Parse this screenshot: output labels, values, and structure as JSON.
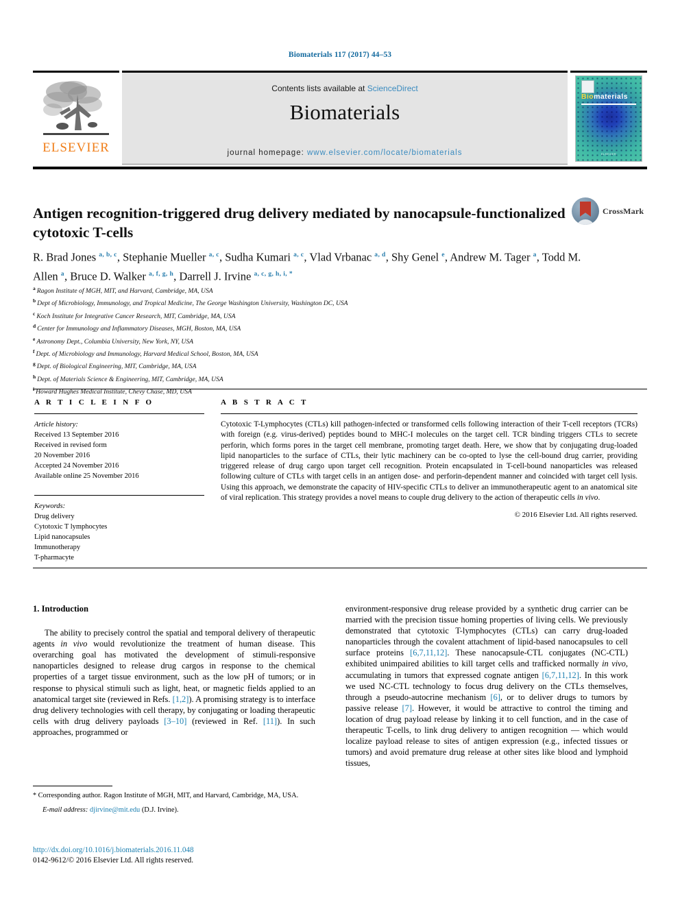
{
  "running_head": "Biomaterials 117 (2017) 44–53",
  "masthead": {
    "publisher_name": "ELSEVIER",
    "publisher_logo_icon": "elsevier-tree-icon",
    "contents_prefix": "Contents lists available at ",
    "contents_link": "ScienceDirect",
    "journal_name": "Biomaterials",
    "homepage_prefix": "journal homepage: ",
    "homepage_link": "www.elsevier.com/locate/biomaterials",
    "cover": {
      "title_first": "Bio",
      "title_rest": "materials",
      "footer": "ELSEVIER"
    }
  },
  "article": {
    "title": "Antigen recognition-triggered drug delivery mediated by nanocapsule-functionalized cytotoxic T-cells",
    "crossmark_label": "CrossMark",
    "authors": [
      {
        "name": "R. Brad Jones",
        "marks": "a, b, c",
        "sep": ", "
      },
      {
        "name": "Stephanie Mueller",
        "marks": "a, c",
        "sep": ", "
      },
      {
        "name": "Sudha Kumari",
        "marks": "a, c",
        "sep": ", "
      },
      {
        "name": "Vlad Vrbanac",
        "marks": "a, d",
        "sep": ", "
      },
      {
        "name": "Shy Genel",
        "marks": "e",
        "sep": ", "
      },
      {
        "name": "Andrew M. Tager",
        "marks": "a",
        "sep": ", "
      },
      {
        "name": "Todd M. Allen",
        "marks": "a",
        "sep": ", "
      },
      {
        "name": "Bruce D. Walker",
        "marks": "a, f, g, h",
        "sep": ", "
      },
      {
        "name": "Darrell J. Irvine",
        "marks": "a, c, g, h, i, *",
        "sep": ""
      }
    ],
    "affiliations": [
      {
        "mark": "a",
        "text": "Ragon Institute of MGH, MIT, and Harvard, Cambridge, MA, USA"
      },
      {
        "mark": "b",
        "text": "Dept of Microbiology, Immunology, and Tropical Medicine, The George Washington University, Washington DC, USA"
      },
      {
        "mark": "c",
        "text": "Koch Institute for Integrative Cancer Research, MIT, Cambridge, MA, USA"
      },
      {
        "mark": "d",
        "text": "Center for Immunology and Inflammatory Diseases, MGH, Boston, MA, USA"
      },
      {
        "mark": "e",
        "text": "Astronomy Dept., Columbia University, New York, NY, USA"
      },
      {
        "mark": "f",
        "text": "Dept. of Microbiology and Immunology, Harvard Medical School, Boston, MA, USA"
      },
      {
        "mark": "g",
        "text": "Dept. of Biological Engineering, MIT, Cambridge, MA, USA"
      },
      {
        "mark": "h",
        "text": "Dept. of Materials Science & Engineering, MIT, Cambridge, MA, USA"
      },
      {
        "mark": "i",
        "text": "Howard Hughes Medical Institute, Chevy Chase, MD, USA"
      }
    ]
  },
  "article_info": {
    "heading": "A R T I C L E   I N F O",
    "history_label": "Article history:",
    "history": [
      "Received 13 September 2016",
      "Received in revised form",
      "20 November 2016",
      "Accepted 24 November 2016",
      "Available online 25 November 2016"
    ],
    "keywords_label": "Keywords:",
    "keywords": [
      "Drug delivery",
      "Cytotoxic T lymphocytes",
      "Lipid nanocapsules",
      "Immunotherapy",
      "T-pharmacyte"
    ]
  },
  "abstract": {
    "heading": "A B S T R A C T",
    "text": "Cytotoxic T-Lymphocytes (CTLs) kill pathogen-infected or transformed cells following interaction of their T-cell receptors (TCRs) with foreign (e.g. virus-derived) peptides bound to MHC-I molecules on the target cell. TCR binding triggers CTLs to secrete perforin, which forms pores in the target cell membrane, promoting target death. Here, we show that by conjugating drug-loaded lipid nanoparticles to the surface of CTLs, their lytic machinery can be co-opted to lyse the cell-bound drug carrier, providing triggered release of drug cargo upon target cell recognition. Protein encapsulated in T-cell-bound nanoparticles was released following culture of CTLs with target cells in an antigen dose- and perforin-dependent manner and coincided with target cell lysis. Using this approach, we demonstrate the capacity of HIV-specific CTLs to deliver an immunotherapeutic agent to an anatomical site of viral replication. This strategy provides a novel means to couple drug delivery to the action of therapeutic cells ",
    "text_italic_tail": "in vivo",
    "text_tail": ".",
    "copyright": "© 2016 Elsevier Ltd. All rights reserved."
  },
  "introduction": {
    "heading": "1. Introduction",
    "left_paragraph_1": "The ability to precisely control the spatial and temporal delivery of therapeutic agents ",
    "left_italic_1": "in vivo",
    "left_paragraph_1b": " would revolutionize the treatment of human disease. This overarching goal has motivated the development of stimuli-responsive nanoparticles designed to release drug cargos in response to the chemical properties of a target tissue environment, such as the low pH of tumors; or in response to physical stimuli such as light, heat, or magnetic fields applied to an anatomical target site (reviewed in Refs. ",
    "ref_1_2": "[1,2]",
    "left_paragraph_1c": "). A promising strategy is to interface drug delivery technologies with cell therapy, by conjugating or loading therapeutic cells with drug delivery payloads ",
    "ref_3_10": "[3–10]",
    "left_paragraph_1d": " (reviewed in Ref. ",
    "ref_11": "[11]",
    "left_paragraph_1e": "). In such approaches, programmed or",
    "right_paragraph_1": "environment-responsive drug release provided by a synthetic drug carrier can be married with the precision tissue homing properties of living cells. We previously demonstrated that cytotoxic T-lymphocytes (CTLs) can carry drug-loaded nanoparticles through the covalent attachment of lipid-based nanocapsules to cell surface proteins ",
    "ref_6_7_11_12_a": "[6,7,11,12]",
    "right_paragraph_1b": ". These nanocapsule-CTL conjugates (NC-CTL) exhibited unimpaired abilities to kill target cells and trafficked normally ",
    "right_italic_1": "in vivo",
    "right_paragraph_1c": ", accumulating in tumors that expressed cognate antigen ",
    "ref_6_7_11_12_b": "[6,7,11,12]",
    "right_paragraph_1d": ". In this work we used NC-CTL technology to focus drug delivery on the CTLs themselves, through a pseudo-autocrine mechanism ",
    "ref_6": "[6]",
    "right_paragraph_1e": ", or to deliver drugs to tumors by passive release ",
    "ref_7": "[7]",
    "right_paragraph_1f": ". However, it would be attractive to control the timing and location of drug payload release by linking it to cell function, and in the case of therapeutic T-cells, to link drug delivery to antigen recognition — which would localize payload release to sites of antigen expression (e.g., infected tissues or tumors) and avoid premature drug release at other sites like blood and lymphoid tissues,"
  },
  "footnote": {
    "star": "*",
    "text": " Corresponding author. Ragon Institute of MGH, MIT, and Harvard, Cambridge, MA, USA.",
    "email_label": "E-mail address:",
    "email": "djirvine@mit.edu",
    "email_suffix": " (D.J. Irvine)."
  },
  "doi": {
    "url": "http://dx.doi.org/10.1016/j.biomaterials.2016.11.048",
    "issn_line": "0142-9612/© 2016 Elsevier Ltd. All rights reserved."
  },
  "colors": {
    "link_blue": "#1b7fb0",
    "header_blue": "#12699e",
    "elsevier_orange": "#f07e18",
    "masthead_grey": "#e4e4e4"
  }
}
